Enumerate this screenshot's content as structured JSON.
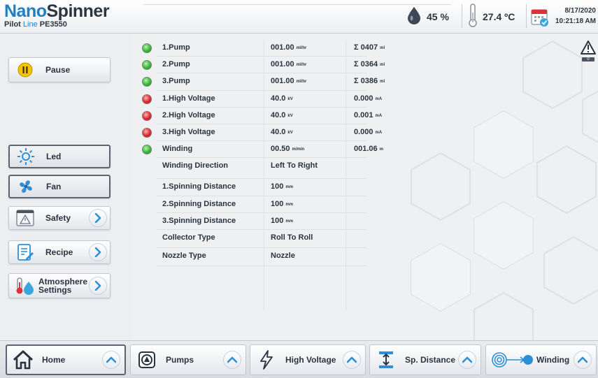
{
  "header": {
    "brand_nano": "Nano",
    "brand_spinner": "Spinner",
    "sub_pilot": "Pilot",
    "sub_line": "Line",
    "sub_model": "PE3550",
    "humidity": "45 %",
    "temperature": "27.4 ºC",
    "date": "8/17/2020",
    "time": "10:21:18 AM",
    "icons": [
      "water-drop-icon",
      "thermometer-icon",
      "calendar-icon"
    ]
  },
  "left_menu": {
    "pause": "Pause",
    "led": "Led",
    "fan": "Fan",
    "safety": "Safety",
    "recipe": "Recipe",
    "atmosphere_line1": "Atmosphere",
    "atmosphere_line2": "Settings"
  },
  "table": {
    "rows": [
      {
        "status": "green",
        "name": "1.Pump",
        "value": "001.00",
        "value_unit": "ml/hr",
        "total": "Σ 0407",
        "total_unit": "ml"
      },
      {
        "status": "green",
        "name": "2.Pump",
        "value": "001.00",
        "value_unit": "ml/hr",
        "total": "Σ 0364",
        "total_unit": "ml"
      },
      {
        "status": "green",
        "name": "3.Pump",
        "value": "001.00",
        "value_unit": "ml/hr",
        "total": "Σ 0386",
        "total_unit": "ml"
      },
      {
        "status": "red",
        "name": "1.High Voltage",
        "value": "40.0",
        "value_unit": "kV",
        "total": "0.000",
        "total_unit": "mA"
      },
      {
        "status": "red",
        "name": "2.High Voltage",
        "value": "40.0",
        "value_unit": "kV",
        "total": "0.001",
        "total_unit": "mA"
      },
      {
        "status": "red",
        "name": "3.High Voltage",
        "value": "40.0",
        "value_unit": "kV",
        "total": "0.000",
        "total_unit": "mA"
      },
      {
        "status": "green",
        "name": "Winding",
        "value": "00.50",
        "value_unit": "m/min",
        "total": "001.06",
        "total_unit": "m"
      },
      {
        "status": "",
        "name": "Winding Direction",
        "value": "Left To Right",
        "value_unit": "",
        "total": "",
        "total_unit": ""
      },
      {
        "status": "",
        "name": "1.Spinning Distance",
        "value": "100",
        "value_unit": "mm",
        "total": "",
        "total_unit": ""
      },
      {
        "status": "",
        "name": "2.Spinning Distance",
        "value": "100",
        "value_unit": "mm",
        "total": "",
        "total_unit": ""
      },
      {
        "status": "",
        "name": "3.Spinning Distance",
        "value": "100",
        "value_unit": "mm",
        "total": "",
        "total_unit": ""
      },
      {
        "status": "",
        "name": "Collector Type",
        "value": "Roll To Roll",
        "value_unit": "",
        "total": "",
        "total_unit": ""
      },
      {
        "status": "",
        "name": "Nozzle Type",
        "value": "Nozzle",
        "value_unit": "",
        "total": "",
        "total_unit": ""
      }
    ]
  },
  "bottom_nav": {
    "home": "Home",
    "pumps": "Pumps",
    "high_voltage": "High Voltage",
    "sp_distance": "Sp. Distance",
    "winding": "Winding"
  },
  "warning_badge": "0",
  "colors": {
    "accent_blue": "#1f7fc4",
    "status_green": "#39b33b",
    "status_red": "#e0262c",
    "pause_yellow": "#f5c400"
  }
}
